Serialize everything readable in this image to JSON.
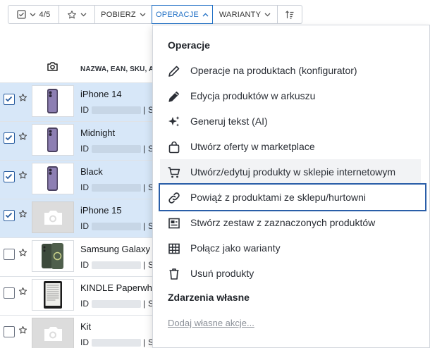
{
  "toolbar": {
    "selection_count": "4/5",
    "pobierz_label": "POBIERZ",
    "operacje_label": "OPERACJE",
    "warianty_label": "WARIANTY"
  },
  "table": {
    "name_header": "NAZWA, EAN, SKU, A",
    "id_prefix": "ID",
    "separator": "|",
    "s_prefix": "S",
    "rows": [
      {
        "name": "iPhone 14",
        "selected": true,
        "thumb": "phone-purple"
      },
      {
        "name": "Midnight",
        "selected": true,
        "thumb": "phone-purple"
      },
      {
        "name": "Black",
        "selected": true,
        "thumb": "phone-purple"
      },
      {
        "name": "iPhone 15",
        "selected": true,
        "thumb": "placeholder"
      },
      {
        "name": "Samsung Galaxy",
        "selected": false,
        "thumb": "samsung"
      },
      {
        "name": "KINDLE Paperwh",
        "selected": false,
        "thumb": "kindle"
      },
      {
        "name": "Kit",
        "selected": false,
        "thumb": "placeholder"
      }
    ]
  },
  "menu": {
    "heading_operations": "Operacje",
    "items": [
      {
        "label": "Operacje na produktach (konfigurator)",
        "icon": "pencil-icon"
      },
      {
        "label": "Edycja produktów w arkuszu",
        "icon": "pencil-icon"
      },
      {
        "label": "Generuj tekst (AI)",
        "icon": "sparkle-icon"
      },
      {
        "label": "Utwórz oferty w marketplace",
        "icon": "shopping-bag-icon"
      },
      {
        "label": "Utwórz/edytuj produkty w sklepie internetowym",
        "icon": "cart-icon"
      },
      {
        "label": "Powiąż z produktami ze sklepu/hurtowni",
        "icon": "link-icon"
      },
      {
        "label": "Stwórz zestaw z zaznaczonych produktów",
        "icon": "bundle-icon"
      },
      {
        "label": "Połącz jako warianty",
        "icon": "grid-icon"
      },
      {
        "label": "Usuń produkty",
        "icon": "trash-icon"
      }
    ],
    "heading_custom": "Zdarzenia własne",
    "add_action_link": "Dodaj własne akcje..."
  },
  "colors": {
    "accent": "#1f6fc5",
    "selected_row": "#d7e7f8",
    "focus_outline": "#2a5ea8"
  }
}
